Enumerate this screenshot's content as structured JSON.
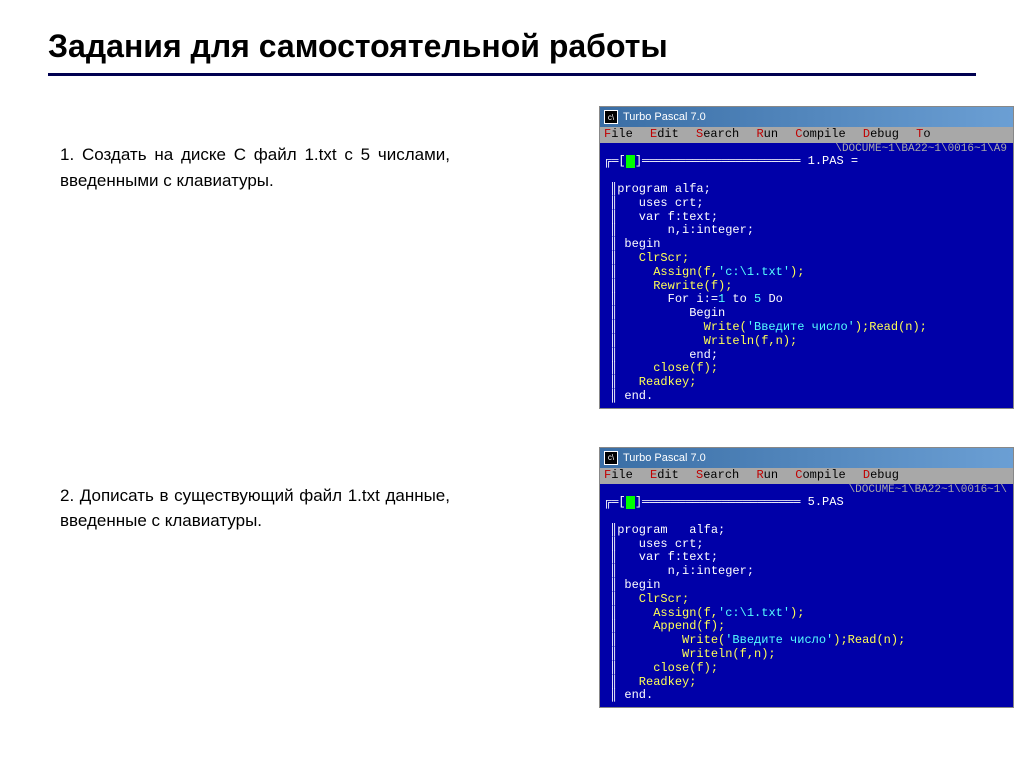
{
  "slide": {
    "title": "Задания для самостоятельной работы"
  },
  "task1": {
    "text": "1. Создать  на   диске   С   файл   1.txt  с   5 числами,  введенными с клавиатуры."
  },
  "task2": {
    "text": "2. Дописать  в  существующий  файл  1.txt данные,  введенные с клавиатуры."
  },
  "tp1": {
    "title": "Turbo Pascal 7.0",
    "path": "\\DOCUME~1\\BA22~1\\0016~1\\A9",
    "filetab": "1.PAS =",
    "code": {
      "l1": "program alfa;",
      "l2": "   uses crt;",
      "l3": "   var f:text;",
      "l4": "       n,i:integer;",
      "l5": " begin",
      "l6": "   ClrScr;",
      "l7a": "     Assign(f,",
      "l7b": "'c:\\1.txt'",
      "l7c": ");",
      "l8": "     Rewrite(f);",
      "l9a": "       For i:=",
      "l9b": "1",
      "l9c": " to ",
      "l9d": "5",
      "l9e": " Do",
      "l10": "          Begin",
      "l11a": "            Write(",
      "l11b": "'Введите число'",
      "l11c": ");Read(n);",
      "l12": "            Writeln(f,n);",
      "l13": "          end;",
      "l14": "     close(f);",
      "l15": "   Readkey;",
      "l16": " end."
    }
  },
  "tp2": {
    "title": "Turbo Pascal 7.0",
    "path": "\\DOCUME~1\\BA22~1\\0016~1\\",
    "filetab": "5.PAS",
    "code": {
      "l1": "program   alfa;",
      "l2": "   uses crt;",
      "l3": "   var f:text;",
      "l4": "       n,i:integer;",
      "l5": " begin",
      "l6": "   ClrScr;",
      "l7a": "     Assign(f,",
      "l7b": "'c:\\1.txt'",
      "l7c": ");",
      "l8": "     Append(f);",
      "l11a": "         Write(",
      "l11b": "'Введите число'",
      "l11c": ");Read(n);",
      "l12": "         Writeln(f,n);",
      "l14": "     close(f);",
      "l15": "   Readkey;",
      "l16": " end."
    }
  },
  "menubar": {
    "file": "File",
    "edit": "Edit",
    "search": "Search",
    "run": "Run",
    "compile": "Compile",
    "debug": "Debug",
    "tools": "To"
  }
}
